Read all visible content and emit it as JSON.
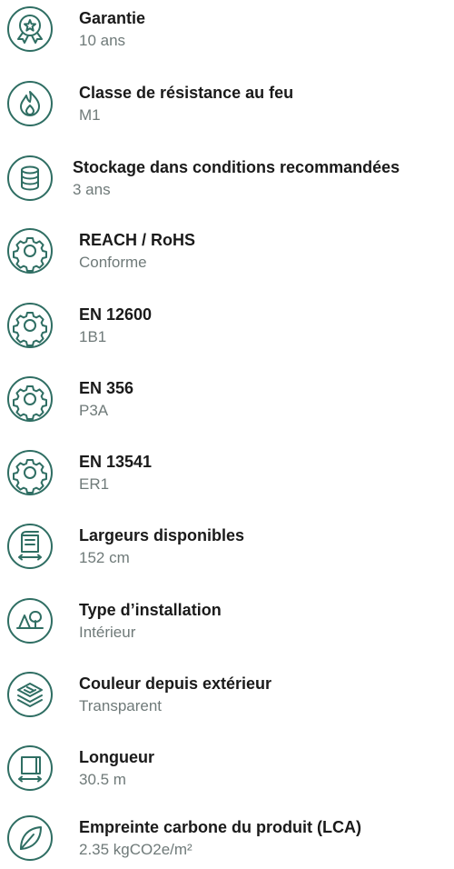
{
  "accent_color": "#2f6e63",
  "specs": [
    {
      "icon": "award-icon",
      "title": "Garantie",
      "value": "10 ans"
    },
    {
      "icon": "flame-icon",
      "title": "Classe de résistance au feu",
      "value": "M1"
    },
    {
      "icon": "database-icon",
      "title": "Stockage dans conditions recommandées",
      "value": "3 ans"
    },
    {
      "icon": "gear-icon",
      "title": "REACH / RoHS",
      "value": "Conforme"
    },
    {
      "icon": "gear-icon",
      "title": "EN 12600",
      "value": "1B1"
    },
    {
      "icon": "gear-icon",
      "title": "EN 356",
      "value": "P3A"
    },
    {
      "icon": "gear-icon",
      "title": "EN 13541",
      "value": "ER1"
    },
    {
      "icon": "roll-width-icon",
      "title": "Largeurs disponibles",
      "value": "152 cm"
    },
    {
      "icon": "indoor-tree-icon",
      "title": "Type d’installation",
      "value": "Intérieur"
    },
    {
      "icon": "layers-icon",
      "title": "Couleur depuis extérieur",
      "value": "Transparent"
    },
    {
      "icon": "length-icon",
      "title": "Longueur",
      "value": "30.5 m"
    },
    {
      "icon": "leaf-icon",
      "title": "Empreinte carbone du produit (LCA)",
      "value": "2.35 kgCO2e/m²"
    }
  ]
}
